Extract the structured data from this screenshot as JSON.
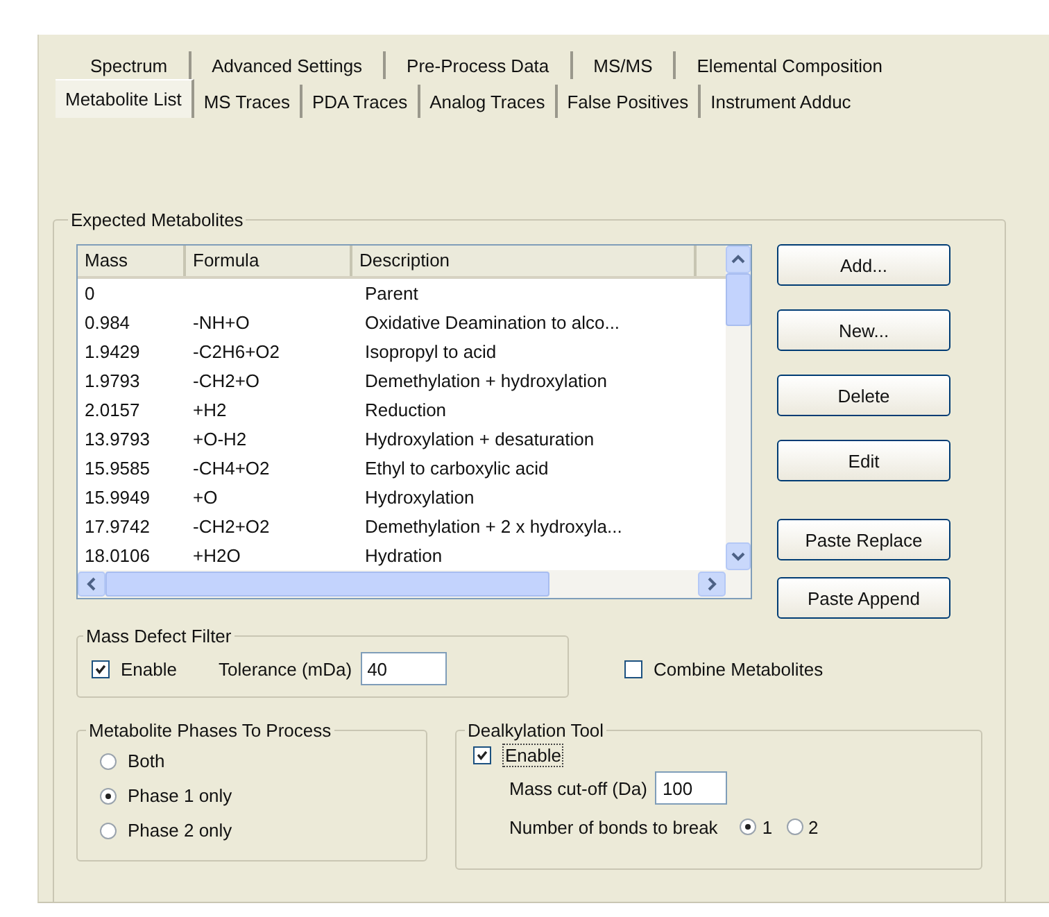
{
  "tabs_row_1": [
    {
      "label": "Spectrum",
      "selected": false
    },
    {
      "label": "Advanced Settings",
      "selected": false
    },
    {
      "label": "Pre-Process Data",
      "selected": false
    },
    {
      "label": "MS/MS",
      "selected": false
    },
    {
      "label": "Elemental Composition",
      "selected": false
    }
  ],
  "tabs_row_2": [
    {
      "label": "Metabolite List",
      "selected": true
    },
    {
      "label": "MS Traces",
      "selected": false
    },
    {
      "label": "PDA Traces",
      "selected": false
    },
    {
      "label": "Analog Traces",
      "selected": false
    },
    {
      "label": "False Positives",
      "selected": false
    },
    {
      "label": "Instrument Adduc",
      "selected": false
    }
  ],
  "expected_metabolites": {
    "title": "Expected Metabolites",
    "columns": [
      "Mass",
      "Formula",
      "Description"
    ],
    "rows": [
      {
        "mass": "0",
        "description": "Parent"
      },
      {
        "mass": "0.984",
        "formula": "-NH+O",
        "description": "Oxidative Deamination to alco..."
      },
      {
        "mass": "1.9429",
        "formula": "-C2H6+O2",
        "description": "Isopropyl to acid"
      },
      {
        "mass": "1.9793",
        "formula": "-CH2+O",
        "description": "Demethylation + hydroxylation"
      },
      {
        "mass": "2.0157",
        "formula": "+H2",
        "description": "Reduction"
      },
      {
        "mass": "13.9793",
        "formula": "+O-H2",
        "description": "Hydroxylation + desaturation"
      },
      {
        "mass": "15.9585",
        "formula": "-CH4+O2",
        "description": "Ethyl to carboxylic acid"
      },
      {
        "mass": "15.9949",
        "formula": "+O",
        "description": "Hydroxylation"
      },
      {
        "mass": "17.9742",
        "formula": "-CH2+O2",
        "description": "Demethylation + 2 x hydroxyla..."
      },
      {
        "mass": "18.0106",
        "formula": "+H2O",
        "description": "Hydration"
      }
    ],
    "buttons": [
      "Add...",
      "New...",
      "Delete",
      "Edit",
      "Paste Replace",
      "Paste Append"
    ]
  },
  "mass_defect_filter": {
    "title": "Mass Defect Filter",
    "enable": {
      "label": "Enable",
      "checked": true
    },
    "tolerance": {
      "label": "Tolerance (mDa)",
      "value": "40"
    }
  },
  "combine_metabolites": {
    "label": "Combine Metabolites",
    "checked": false
  },
  "phases": {
    "title": "Metabolite Phases To Process",
    "options": [
      {
        "label": "Both",
        "selected": false
      },
      {
        "label": "Phase 1 only",
        "selected": true
      },
      {
        "label": "Phase 2 only",
        "selected": false
      }
    ]
  },
  "dealkylation": {
    "title": "Dealkylation Tool",
    "enable": {
      "label": "Enable",
      "checked": true
    },
    "cutoff": {
      "label": "Mass cut-off (Da)",
      "value": "100"
    },
    "bonds": {
      "label": "Number of bonds to break",
      "options": [
        {
          "label": "1",
          "selected": true
        },
        {
          "label": "2",
          "selected": false
        }
      ]
    }
  }
}
